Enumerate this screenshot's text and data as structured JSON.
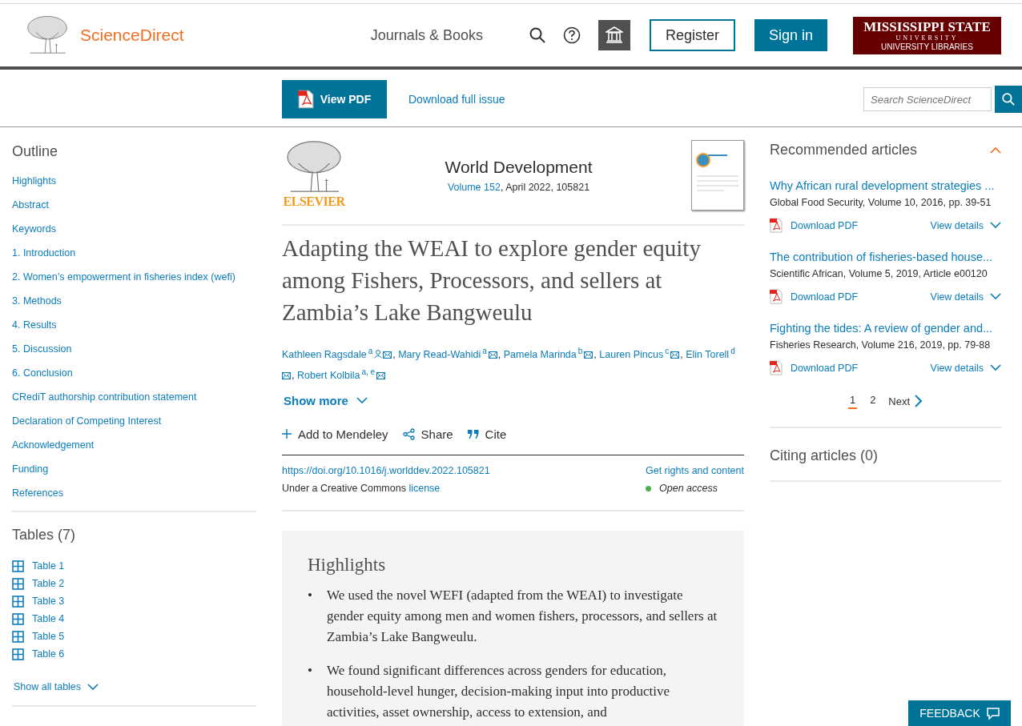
{
  "header": {
    "brand": "ScienceDirect",
    "nav": "Journals & Books",
    "register": "Register",
    "sign_in": "Sign in",
    "institution": [
      "MISSISSIPPI STATE",
      "UNIVERSITY",
      "UNIVERSITY LIBRARIES"
    ]
  },
  "toolbar": {
    "view_pdf": "View PDF",
    "download_issue": "Download full issue",
    "search": {
      "placeholder": "Search ScienceDirect"
    }
  },
  "outline": {
    "title": "Outline",
    "items": [
      "Highlights",
      "Abstract",
      "Keywords",
      "1. Introduction",
      "2. Women’s empowerment in fisheries index (wefi)",
      "3. Methods",
      "4. Results",
      "5. Discussion",
      "6. Conclusion",
      "CRediT authorship contribution statement",
      "Declaration of Competing Interest",
      "Acknowledgement",
      "Funding",
      "References"
    ]
  },
  "tables": {
    "title": "Tables (7)",
    "items": [
      "Table 1",
      "Table 2",
      "Table 3",
      "Table 4",
      "Table 5",
      "Table 6"
    ],
    "show_all": "Show all tables"
  },
  "article": {
    "publisher": "ELSEVIER",
    "journal": "World Development",
    "volume_link": "Volume 152",
    "issue_info": ", April 2022, 105821",
    "title": "Adapting the WEAI to explore gender equity among Fishers, Processors, and sellers at Zambia’s Lake Bangweulu",
    "authors": [
      {
        "name": "Kathleen Ragsdale",
        "sup": "a",
        "corresponding": true,
        "separator": ","
      },
      {
        "name": "Mary Read-Wahidi",
        "sup": "a",
        "corresponding": false,
        "separator": ","
      },
      {
        "name": "Pamela Marinda",
        "sup": "b",
        "corresponding": false,
        "separator": ","
      },
      {
        "name": "Lauren Pincus",
        "sup": "c",
        "corresponding": false,
        "separator": ","
      },
      {
        "name": "Elin Torell",
        "sup": "d",
        "corresponding": false,
        "separator": ","
      },
      {
        "name": "Robert Kolbila",
        "sup": "a, e",
        "corresponding": false
      }
    ],
    "show_more": "Show more",
    "actions": [
      {
        "kind": "add",
        "label": "Add to Mendeley"
      },
      {
        "kind": "share",
        "label": "Share"
      },
      {
        "kind": "cite",
        "label": "Cite"
      }
    ],
    "doi": "https://doi.org/10.1016/j.worlddev.2022.105821",
    "rights": "Get rights and content",
    "license_text": "Under a Creative Commons",
    "license_link": "license",
    "access": "Open access"
  },
  "highlights": {
    "title": "Highlights",
    "bullet": "•",
    "items": [
      "We used the novel WEFI (adapted from the WEAI) to investigate gender equity among men and women fishers, processors, and sellers at Zambia’s Lake Bangweulu.",
      "We found significant differences across genders for education, household-level hunger, decision-making input into productive activities, asset ownership, access to extension, and"
    ]
  },
  "recommended": {
    "title": "Recommended articles",
    "expanded": true,
    "articles": [
      {
        "title": "Why African rural development strategies ...",
        "source": "Global Food Security, Volume 10, 2016, pp. 39-51",
        "download": "Download PDF",
        "details": "View details"
      },
      {
        "title": "The contribution of fisheries-based house...",
        "source": "Scientific African, Volume 5, 2019, Article e00120",
        "download": "Download PDF",
        "details": "View details"
      },
      {
        "title": "Fighting the tides: A review of gender and...",
        "source": "Fisheries Research, Volume 216, 2019, pp. 79-88",
        "download": "Download PDF",
        "details": "View details"
      }
    ],
    "pages": [
      {
        "label": "1",
        "selected": true
      },
      {
        "label": "2",
        "selected": false
      }
    ],
    "next": "Next"
  },
  "citing": {
    "title": "Citing articles (0)"
  },
  "feedback": "FEEDBACK"
}
